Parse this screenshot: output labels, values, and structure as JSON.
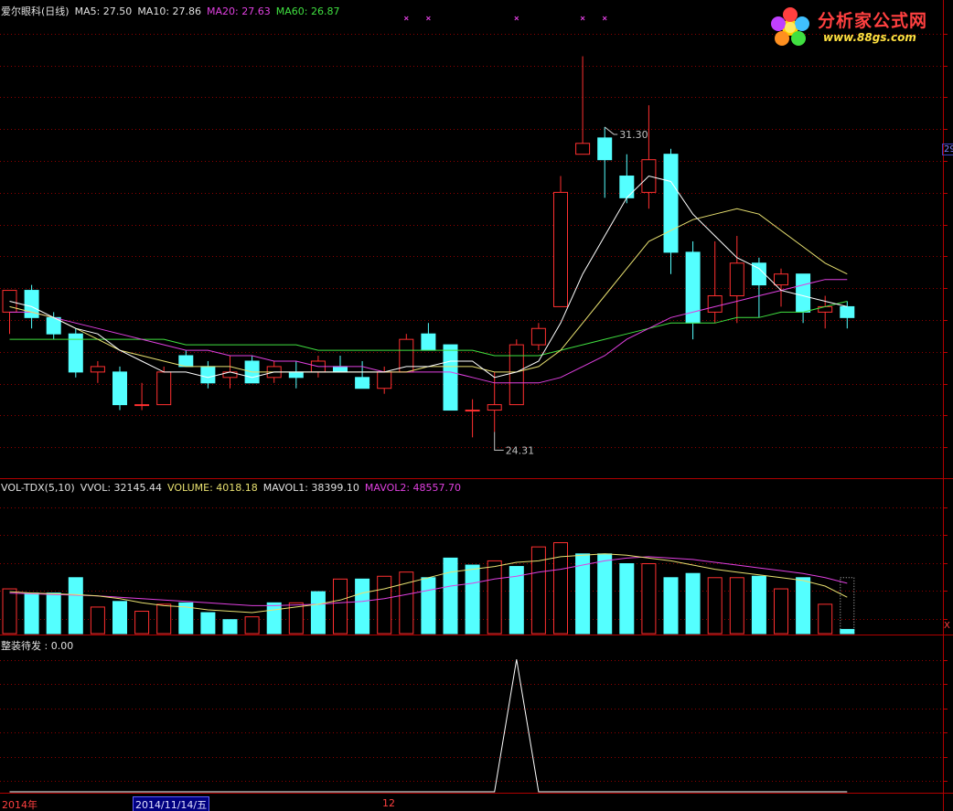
{
  "header": {
    "title": "爱尔眼科(日线)",
    "ma5_label": "MA5: 27.50",
    "ma10_label": "MA10: 27.86",
    "ma20_label": "MA20: 27.63",
    "ma60_label": "MA60: 26.87"
  },
  "vol_header": {
    "title": "VOL-TDX(5,10)",
    "vvol_label": "VVOL: 32145.44",
    "volume_label": "VOLUME: 4018.18",
    "mavol1_label": "MAVOL1: 38399.10",
    "mavol2_label": "MAVOL2: 48557.70"
  },
  "ind_header": {
    "title": "整装待发 : 0.00"
  },
  "logo": {
    "text_cn": "分析家公式网",
    "text_url": "www.88gs.com"
  },
  "xaxis": {
    "labels": [
      "2014年",
      "2014/11/14/五",
      "12"
    ]
  },
  "right_axis": {
    "price_marker": "29",
    "vol_marker": "X"
  },
  "colors": {
    "up": "#ff3030",
    "down": "#54ffff",
    "ma5": "#ffffff",
    "ma10": "#e8e070",
    "ma20": "#e040e0",
    "ma60": "#40e040",
    "grid": "#900000"
  },
  "chart_data": [
    {
      "type": "candlestick",
      "ylim": [
        23.6,
        32.3
      ],
      "high_label": "31.30",
      "low_label": "24.31",
      "high_index": 27,
      "low_index": 22,
      "signal_marks": [
        18,
        19,
        23,
        26,
        27
      ],
      "candles": [
        {
          "o": 26.6,
          "h": 27.0,
          "l": 26.2,
          "c": 27.0
        },
        {
          "o": 27.0,
          "h": 27.1,
          "l": 26.3,
          "c": 26.5
        },
        {
          "o": 26.5,
          "h": 26.6,
          "l": 26.1,
          "c": 26.2
        },
        {
          "o": 26.2,
          "h": 26.3,
          "l": 25.4,
          "c": 25.5
        },
        {
          "o": 25.5,
          "h": 25.7,
          "l": 25.3,
          "c": 25.6
        },
        {
          "o": 25.5,
          "h": 25.6,
          "l": 24.8,
          "c": 24.9
        },
        {
          "o": 24.9,
          "h": 25.3,
          "l": 24.8,
          "c": 24.9
        },
        {
          "o": 24.9,
          "h": 25.6,
          "l": 24.9,
          "c": 25.5
        },
        {
          "o": 25.8,
          "h": 25.9,
          "l": 25.6,
          "c": 25.6
        },
        {
          "o": 25.6,
          "h": 25.7,
          "l": 25.2,
          "c": 25.3
        },
        {
          "o": 25.4,
          "h": 25.8,
          "l": 25.2,
          "c": 25.5
        },
        {
          "o": 25.7,
          "h": 25.8,
          "l": 25.4,
          "c": 25.3
        },
        {
          "o": 25.4,
          "h": 25.7,
          "l": 25.3,
          "c": 25.6
        },
        {
          "o": 25.5,
          "h": 25.7,
          "l": 25.2,
          "c": 25.4
        },
        {
          "o": 25.5,
          "h": 25.8,
          "l": 25.4,
          "c": 25.7
        },
        {
          "o": 25.6,
          "h": 25.8,
          "l": 25.5,
          "c": 25.5
        },
        {
          "o": 25.4,
          "h": 25.7,
          "l": 25.2,
          "c": 25.2
        },
        {
          "o": 25.2,
          "h": 25.6,
          "l": 25.1,
          "c": 25.5
        },
        {
          "o": 25.5,
          "h": 26.2,
          "l": 25.5,
          "c": 26.1
        },
        {
          "o": 26.2,
          "h": 26.4,
          "l": 25.9,
          "c": 25.9
        },
        {
          "o": 26.0,
          "h": 26.0,
          "l": 24.8,
          "c": 24.8
        },
        {
          "o": 24.8,
          "h": 25.0,
          "l": 24.3,
          "c": 24.8
        },
        {
          "o": 24.8,
          "h": 25.5,
          "l": 24.4,
          "c": 24.9
        },
        {
          "o": 24.9,
          "h": 26.1,
          "l": 24.9,
          "c": 26.0
        },
        {
          "o": 26.0,
          "h": 26.4,
          "l": 25.9,
          "c": 26.3
        },
        {
          "o": 26.7,
          "h": 29.1,
          "l": 26.7,
          "c": 28.8
        },
        {
          "o": 29.5,
          "h": 31.3,
          "l": 29.5,
          "c": 29.7
        },
        {
          "o": 29.8,
          "h": 30.0,
          "l": 28.7,
          "c": 29.4
        },
        {
          "o": 29.1,
          "h": 29.5,
          "l": 28.6,
          "c": 28.7
        },
        {
          "o": 28.8,
          "h": 30.4,
          "l": 28.5,
          "c": 29.4
        },
        {
          "o": 29.5,
          "h": 29.6,
          "l": 27.3,
          "c": 27.7
        },
        {
          "o": 27.7,
          "h": 27.9,
          "l": 26.1,
          "c": 26.4
        },
        {
          "o": 26.6,
          "h": 27.9,
          "l": 26.4,
          "c": 26.9
        },
        {
          "o": 26.9,
          "h": 28.0,
          "l": 26.4,
          "c": 27.5
        },
        {
          "o": 27.5,
          "h": 27.6,
          "l": 26.5,
          "c": 27.1
        },
        {
          "o": 27.1,
          "h": 27.4,
          "l": 26.7,
          "c": 27.3
        },
        {
          "o": 27.3,
          "h": 27.3,
          "l": 26.4,
          "c": 26.6
        },
        {
          "o": 26.6,
          "h": 26.9,
          "l": 26.3,
          "c": 26.7
        },
        {
          "o": 26.7,
          "h": 26.8,
          "l": 26.3,
          "c": 26.5
        }
      ],
      "ma5": [
        26.8,
        26.7,
        26.5,
        26.3,
        26.2,
        25.9,
        25.7,
        25.5,
        25.5,
        25.4,
        25.5,
        25.4,
        25.5,
        25.5,
        25.5,
        25.5,
        25.5,
        25.5,
        25.6,
        25.6,
        25.7,
        25.7,
        25.4,
        25.5,
        25.7,
        26.4,
        27.3,
        28.0,
        28.7,
        29.1,
        29.0,
        28.4,
        28.0,
        27.6,
        27.4,
        27.0,
        26.9,
        26.8,
        26.7
      ],
      "ma10": [
        26.7,
        26.6,
        26.5,
        26.3,
        26.1,
        25.9,
        25.8,
        25.7,
        25.6,
        25.6,
        25.6,
        25.5,
        25.5,
        25.5,
        25.5,
        25.5,
        25.5,
        25.5,
        25.5,
        25.6,
        25.6,
        25.6,
        25.5,
        25.5,
        25.6,
        25.9,
        26.4,
        26.9,
        27.4,
        27.9,
        28.1,
        28.3,
        28.4,
        28.5,
        28.4,
        28.1,
        27.8,
        27.5,
        27.3
      ],
      "ma20": [
        26.6,
        26.6,
        26.5,
        26.4,
        26.3,
        26.2,
        26.1,
        26.0,
        25.9,
        25.9,
        25.8,
        25.8,
        25.7,
        25.7,
        25.6,
        25.6,
        25.6,
        25.5,
        25.5,
        25.5,
        25.5,
        25.4,
        25.3,
        25.3,
        25.3,
        25.4,
        25.6,
        25.8,
        26.1,
        26.3,
        26.5,
        26.6,
        26.7,
        26.8,
        26.9,
        27.0,
        27.1,
        27.2,
        27.2
      ],
      "ma60": [
        26.1,
        26.1,
        26.1,
        26.1,
        26.1,
        26.1,
        26.1,
        26.1,
        26.0,
        26.0,
        26.0,
        26.0,
        26.0,
        26.0,
        25.9,
        25.9,
        25.9,
        25.9,
        25.9,
        25.9,
        25.9,
        25.9,
        25.8,
        25.8,
        25.8,
        25.9,
        26.0,
        26.1,
        26.2,
        26.3,
        26.4,
        26.4,
        26.4,
        26.5,
        26.5,
        26.6,
        26.6,
        26.7,
        26.8
      ]
    },
    {
      "type": "bar",
      "ylim": [
        0,
        100000
      ],
      "volumes": [
        32000,
        29000,
        29000,
        40000,
        19000,
        23000,
        16000,
        21000,
        22000,
        15000,
        10000,
        12000,
        22000,
        22000,
        30000,
        39000,
        39000,
        41000,
        44000,
        40000,
        54000,
        49000,
        52000,
        48000,
        62000,
        65000,
        57000,
        57000,
        50000,
        50000,
        40000,
        43000,
        40000,
        40000,
        41000,
        32000,
        40000,
        21000,
        3000
      ],
      "volume_up": [
        true,
        false,
        false,
        false,
        true,
        false,
        true,
        true,
        false,
        false,
        false,
        true,
        false,
        true,
        false,
        true,
        false,
        true,
        true,
        false,
        false,
        false,
        true,
        false,
        true,
        true,
        false,
        false,
        false,
        true,
        false,
        false,
        true,
        true,
        false,
        true,
        false,
        true,
        false
      ],
      "mavol1": [
        30000,
        29000,
        28500,
        28000,
        27000,
        25000,
        22000,
        20000,
        19000,
        17000,
        16000,
        15000,
        17000,
        19000,
        21000,
        24000,
        29000,
        32000,
        36000,
        40000,
        44000,
        46000,
        48000,
        51000,
        52000,
        55000,
        56000,
        57000,
        56000,
        54000,
        52000,
        49000,
        46000,
        44000,
        42000,
        40000,
        38000,
        34000,
        26000
      ],
      "mavol2": [
        29000,
        28500,
        28000,
        27500,
        27000,
        26000,
        25000,
        24000,
        23000,
        22000,
        21000,
        20000,
        20000,
        20500,
        21000,
        22000,
        23000,
        25000,
        28000,
        31000,
        34000,
        36000,
        39000,
        41000,
        44000,
        46000,
        49000,
        52000,
        54000,
        55000,
        54000,
        53000,
        51000,
        49000,
        47000,
        45000,
        43000,
        40000,
        36000
      ]
    },
    {
      "type": "line",
      "ylim": [
        0,
        1.05
      ],
      "values": [
        0,
        0,
        0,
        0,
        0,
        0,
        0,
        0,
        0,
        0,
        0,
        0,
        0,
        0,
        0,
        0,
        0,
        0,
        0,
        0,
        0,
        0,
        0,
        1,
        0,
        0,
        0,
        0,
        0,
        0,
        0,
        0,
        0,
        0,
        0,
        0,
        0,
        0,
        0
      ]
    }
  ]
}
